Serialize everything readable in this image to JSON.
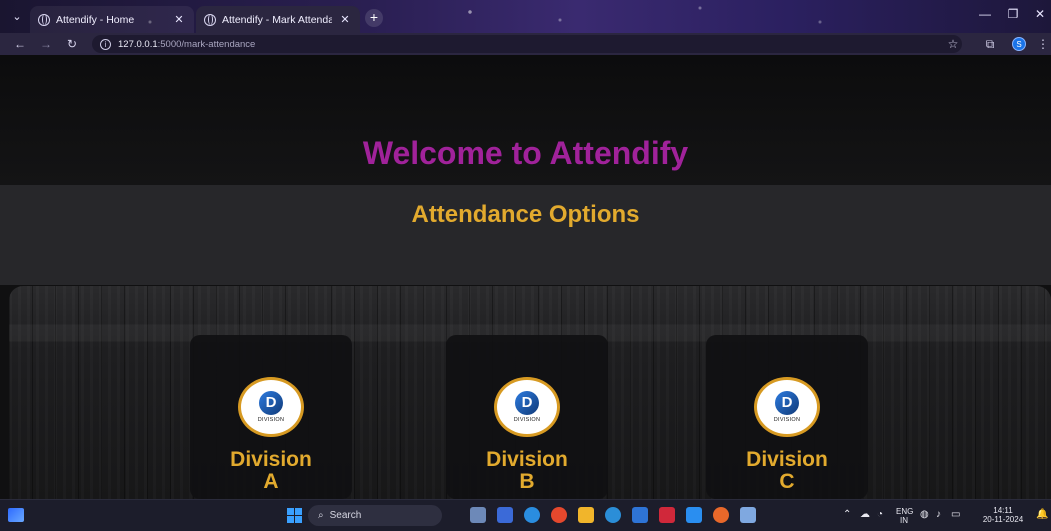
{
  "browser": {
    "tabs": [
      {
        "title": "Attendify - Home",
        "active": false
      },
      {
        "title": "Attendify - Mark Attendance",
        "active": true
      }
    ],
    "url_host": "127.0.0.1",
    "url_rest": ":5000/mark-attendance",
    "profile_initial": "S"
  },
  "page": {
    "welcome": "Welcome to Attendify",
    "options_title": "Attendance Options",
    "divisions": [
      {
        "label": "Division\nA",
        "logo_letter": "D",
        "logo_caption": "DIVISION"
      },
      {
        "label": "Division\nB",
        "logo_letter": "D",
        "logo_caption": "DIVISION"
      },
      {
        "label": "Division\nC",
        "logo_letter": "D",
        "logo_caption": "DIVISION"
      }
    ]
  },
  "colors": {
    "welcome": "#a0229a",
    "accent_gold": "#e2aa2e",
    "logo_ring": "#d79a22"
  },
  "taskbar": {
    "search_label": "Search",
    "language": "ENG",
    "region": "IN",
    "time": "14:11",
    "date": "20-11-2024"
  }
}
